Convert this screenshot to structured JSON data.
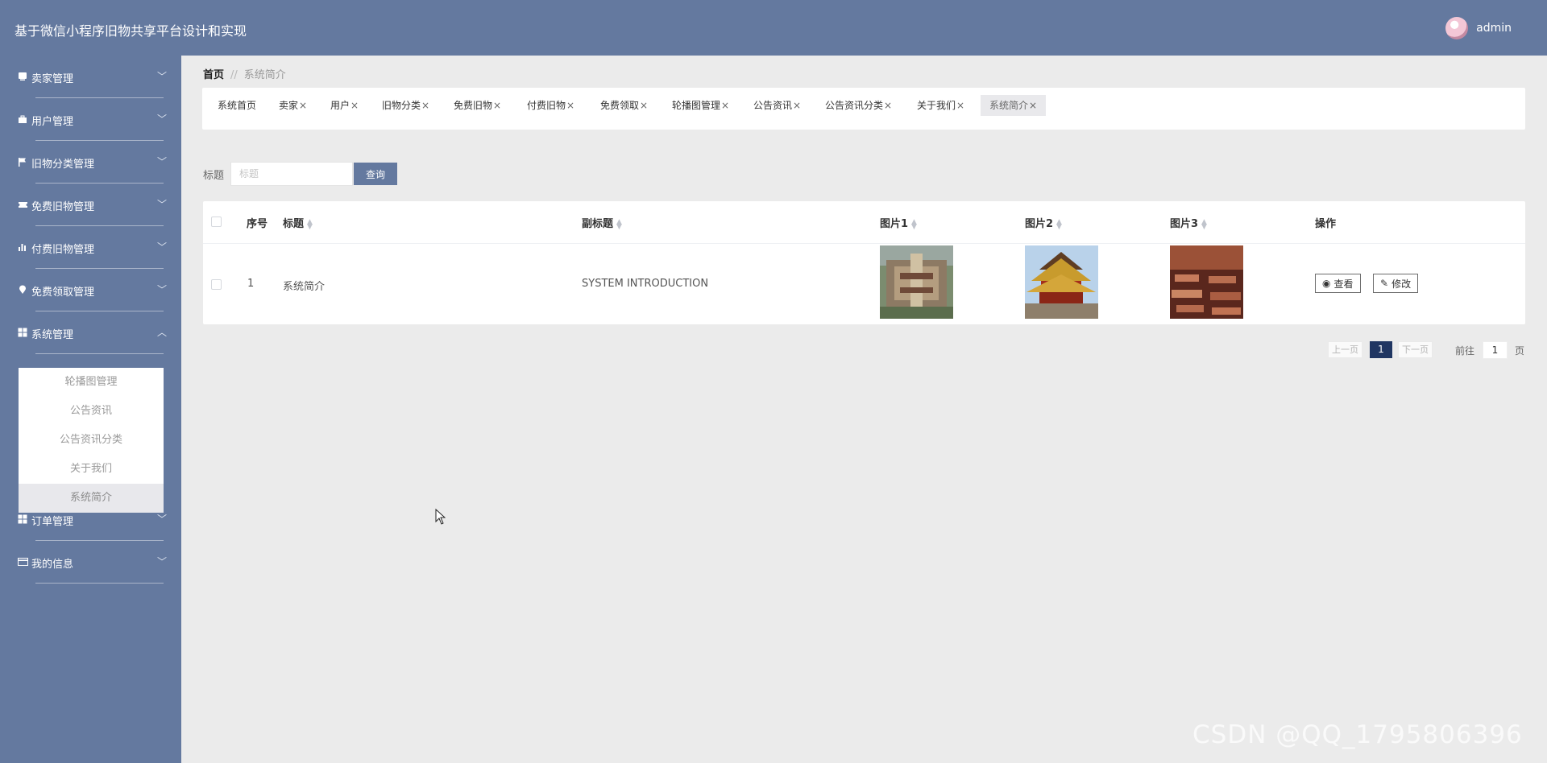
{
  "app": {
    "title": "基于微信小程序旧物共享平台设计和实现",
    "username": "admin"
  },
  "sidebar": {
    "items": [
      {
        "label": "卖家管理",
        "icon": "seller-icon"
      },
      {
        "label": "用户管理",
        "icon": "briefcase-icon"
      },
      {
        "label": "旧物分类管理",
        "icon": "flag-icon"
      },
      {
        "label": "免费旧物管理",
        "icon": "ticket-icon"
      },
      {
        "label": "付费旧物管理",
        "icon": "chart-icon"
      },
      {
        "label": "免费领取管理",
        "icon": "location-icon"
      },
      {
        "label": "系统管理",
        "icon": "grid-icon"
      },
      {
        "label": "订单管理",
        "icon": "grid-icon"
      },
      {
        "label": "我的信息",
        "icon": "card-icon"
      }
    ],
    "submenu": [
      "轮播图管理",
      "公告资讯",
      "公告资讯分类",
      "关于我们",
      "系统简介"
    ]
  },
  "breadcrumb": {
    "home": "首页",
    "separator": "//",
    "current": "系统简介"
  },
  "tabs": [
    "系统首页",
    "卖家",
    "用户",
    "旧物分类",
    "免费旧物",
    "付费旧物",
    "免费领取",
    "轮播图管理",
    "公告资讯",
    "公告资讯分类",
    "关于我们",
    "系统简介"
  ],
  "search": {
    "label": "标题",
    "placeholder": "标题",
    "button": "查询"
  },
  "table": {
    "headers": {
      "index": "序号",
      "title": "标题",
      "subtitle": "副标题",
      "pic1": "图片1",
      "pic2": "图片2",
      "pic3": "图片3",
      "actions": "操作"
    },
    "rows": [
      {
        "index": "1",
        "title": "系统简介",
        "subtitle": "SYSTEM INTRODUCTION"
      }
    ],
    "actions": {
      "view": "查看",
      "edit": "修改"
    }
  },
  "pagination": {
    "prev": "上一页",
    "current": "1",
    "next": "下一页",
    "goto": "前往",
    "page_value": "1",
    "page_suffix": "页"
  },
  "watermark": "CSDN @QQ_1795806396",
  "colors": {
    "primary": "#64799f",
    "background": "#ebebeb",
    "active_page": "#203662"
  }
}
